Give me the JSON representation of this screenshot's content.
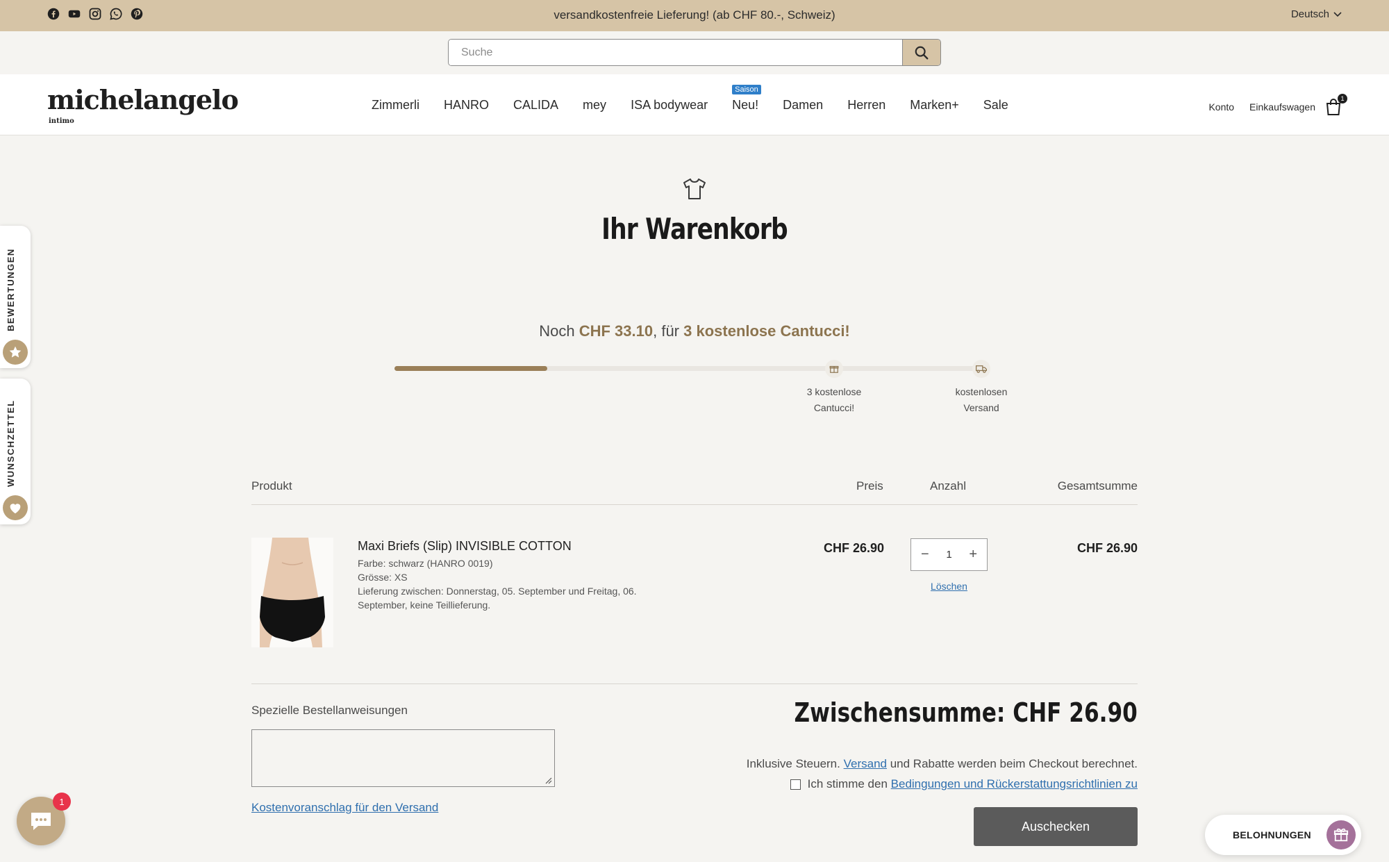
{
  "announcement": {
    "text": "versandkostenfreie Lieferung! (ab CHF 80.-, Schweiz)",
    "language": "Deutsch",
    "social_icons": [
      "facebook-icon",
      "youtube-icon",
      "instagram-icon",
      "whatsapp-icon",
      "pinterest-icon"
    ]
  },
  "search": {
    "placeholder": "Suche",
    "value": ""
  },
  "header": {
    "logo": "michelangelo",
    "logo_sub": "intimo",
    "nav": [
      "Zimmerli",
      "HANRO",
      "CALIDA",
      "mey",
      "ISA bodywear",
      "Neu!",
      "Damen",
      "Herren",
      "Marken+",
      "Sale"
    ],
    "nav_badge": "Saison",
    "account": "Konto",
    "cart": "Einkaufswagen",
    "cart_count": "1"
  },
  "page": {
    "title": "Ihr Warenkorb"
  },
  "progress": {
    "prefix": "Noch ",
    "amount": "CHF 33.10",
    "middle": ", für ",
    "reward": "3 kostenlose Cantucci!",
    "fill_fraction": 0.26,
    "milestones": [
      {
        "line1": "3 kostenlose",
        "line2": "Cantucci!",
        "icon": "gift-icon"
      },
      {
        "line1": "kostenlosen",
        "line2": "Versand",
        "icon": "truck-icon"
      }
    ]
  },
  "table": {
    "headers": {
      "product": "Produkt",
      "price": "Preis",
      "qty": "Anzahl",
      "total": "Gesamtsumme"
    },
    "items": [
      {
        "name": "Maxi Briefs (Slip) INVISIBLE COTTON",
        "color": "Farbe: schwarz (HANRO 0019)",
        "size": "Grösse: XS",
        "delivery": "Lieferung zwischen: Donnerstag, 05. September und Freitag, 06. September, keine Teillieferung.",
        "price": "CHF 26.90",
        "quantity": "1",
        "total": "CHF 26.90",
        "remove": "Löschen"
      }
    ]
  },
  "footer": {
    "notes_label": "Spezielle Bestellanweisungen",
    "estimate_link": "Kostenvoranschlag für den Versand",
    "subtotal": "Zwischensumme: CHF 26.90",
    "tax_prefix": "Inklusive Steuern. ",
    "tax_link": "Versand",
    "tax_suffix": " und Rabatte werden beim Checkout berechnet.",
    "agree_prefix": "Ich stimme den ",
    "agree_link": "Bedingungen und Rückerstattungsrichtlinien zu",
    "checkout": "Auschecken"
  },
  "side": {
    "reviews": "BEWERTUNGEN",
    "wishlist": "WUNSCHZETTEL"
  },
  "widgets": {
    "chat_badge": "1",
    "rewards": "BELOHNUNGEN"
  },
  "colors": {
    "accent": "#d6c4a6",
    "highlight": "#8c744f",
    "link": "#2f6fae",
    "checkout": "#5b5b5b"
  }
}
